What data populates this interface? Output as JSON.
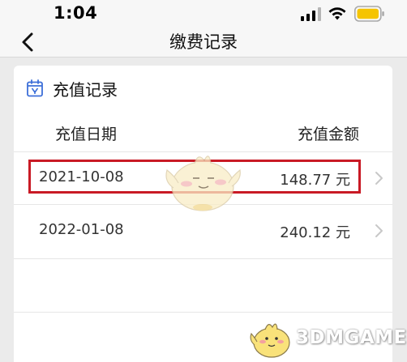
{
  "status_bar": {
    "time": "1:04",
    "signal_icon": "signal-bars-icon",
    "wifi_icon": "wifi-icon",
    "battery_icon": "battery-icon",
    "battery_color": "#f5c400"
  },
  "nav": {
    "back_icon": "chevron-left-icon",
    "title": "缴费记录"
  },
  "card": {
    "icon": "calendar-icon",
    "icon_color": "#3d6fd8",
    "title": "充值记录",
    "columns": {
      "date": "充值日期",
      "amount": "充值金额"
    },
    "rows": [
      {
        "date": "2021-10-08",
        "amount": "148.77 元",
        "highlighted": true
      },
      {
        "date": "2022-01-08",
        "amount": "240.12 元",
        "highlighted": false
      }
    ]
  },
  "highlight_color": "#c91a25",
  "watermark": {
    "text": "3DMGAME"
  }
}
